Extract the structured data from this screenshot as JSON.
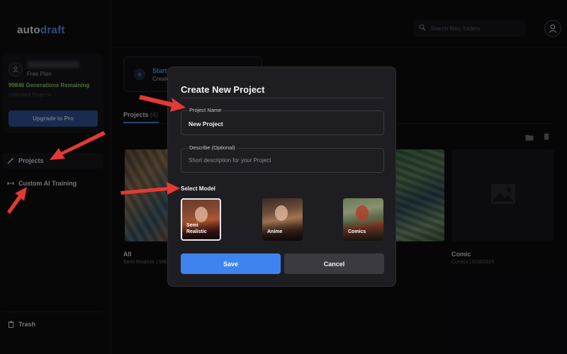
{
  "app": {
    "logo_part1": "auto",
    "logo_part2": "draft"
  },
  "search": {
    "placeholder": "Search files, folders"
  },
  "user_card": {
    "plan": "Free Plan",
    "generations": "99846 Generations Remaining",
    "unlimited": "Unlimited Projects",
    "upgrade_label": "Upgrade to Pro"
  },
  "sidebar": {
    "items": [
      {
        "label": "Projects",
        "icon": "wand-icon"
      },
      {
        "label": "Custom AI Training",
        "icon": "dumbbell-icon"
      }
    ],
    "trash_label": "Trash"
  },
  "main": {
    "start_title": "Start",
    "start_sub": "Create",
    "tab_label": "Projects",
    "tab_count": "(4)",
    "cards": [
      {
        "title": "All",
        "meta": "Semi Realistic | 5/8/"
      },
      {
        "title": "Comic",
        "meta": "Comics | 5/18/2023"
      }
    ]
  },
  "modal": {
    "title": "Create New Project",
    "name_label": "Project Name",
    "name_value": "New Project",
    "desc_label": "Describe (Optional)",
    "desc_placeholder": "Short description for your Project",
    "select_label": "Select Model",
    "models": [
      {
        "name": "Semi Realistic",
        "selected": true
      },
      {
        "name": "Anime",
        "selected": false
      },
      {
        "name": "Comics",
        "selected": false
      }
    ],
    "save_label": "Save",
    "cancel_label": "Cancel"
  },
  "colors": {
    "accent": "#3f83ee",
    "brand": "#5b8ae0",
    "generations": "#8ec76a",
    "arrow": "#e53935"
  }
}
